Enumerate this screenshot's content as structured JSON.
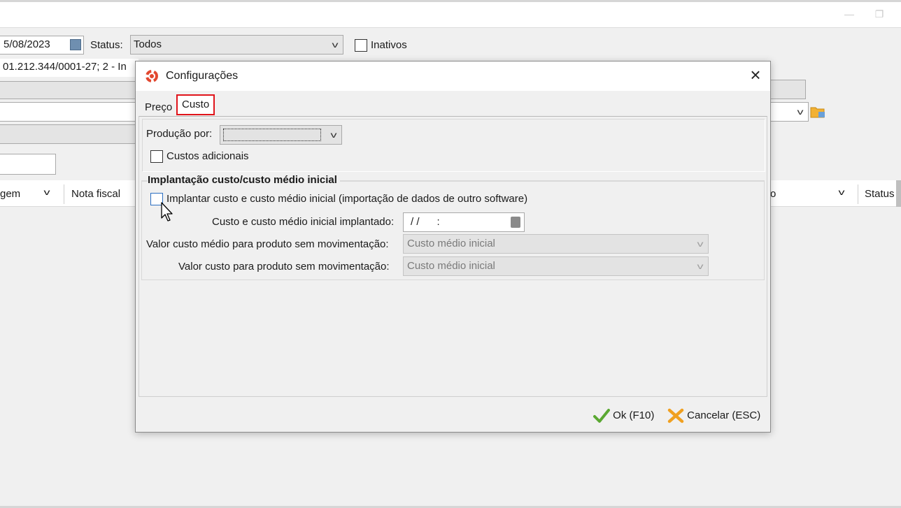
{
  "background": {
    "date_value": "5/08/2023",
    "status_label": "Status:",
    "status_value": "Todos",
    "inativos_label": "Inativos",
    "company_value": "01.212.344/0001-27; 2 - In",
    "grid_columns": [
      "gem",
      "Nota fiscal",
      "o",
      "Status"
    ]
  },
  "dialog": {
    "title": "Configurações",
    "close_icon": "close-icon",
    "tabs": [
      {
        "label": "Preço",
        "active": false
      },
      {
        "label": "Custo",
        "active": true
      }
    ],
    "producao_label": "Produção por:",
    "producao_value": "",
    "custos_adicionais_label": "Custos adicionais",
    "group_title": "Implantação custo/custo médio inicial",
    "implantar_label": "Implantar custo e custo médio inicial (importação de dados de outro software)",
    "implantado_label": "Custo e custo médio inicial implantado:",
    "implantado_value": "/ /      :",
    "valor_medio_label": "Valor custo médio para produto sem movimentação:",
    "valor_medio_value": "Custo médio inicial",
    "valor_custo_label": "Valor custo para produto sem movimentação:",
    "valor_custo_value": "Custo médio inicial",
    "ok_label": "Ok (F10)",
    "cancel_label": "Cancelar (ESC)"
  },
  "colors": {
    "tab_highlight": "#e0141b",
    "ok_icon": "#5aa832",
    "cancel_icon": "#f0a020",
    "app_icon": "#e2472f"
  }
}
